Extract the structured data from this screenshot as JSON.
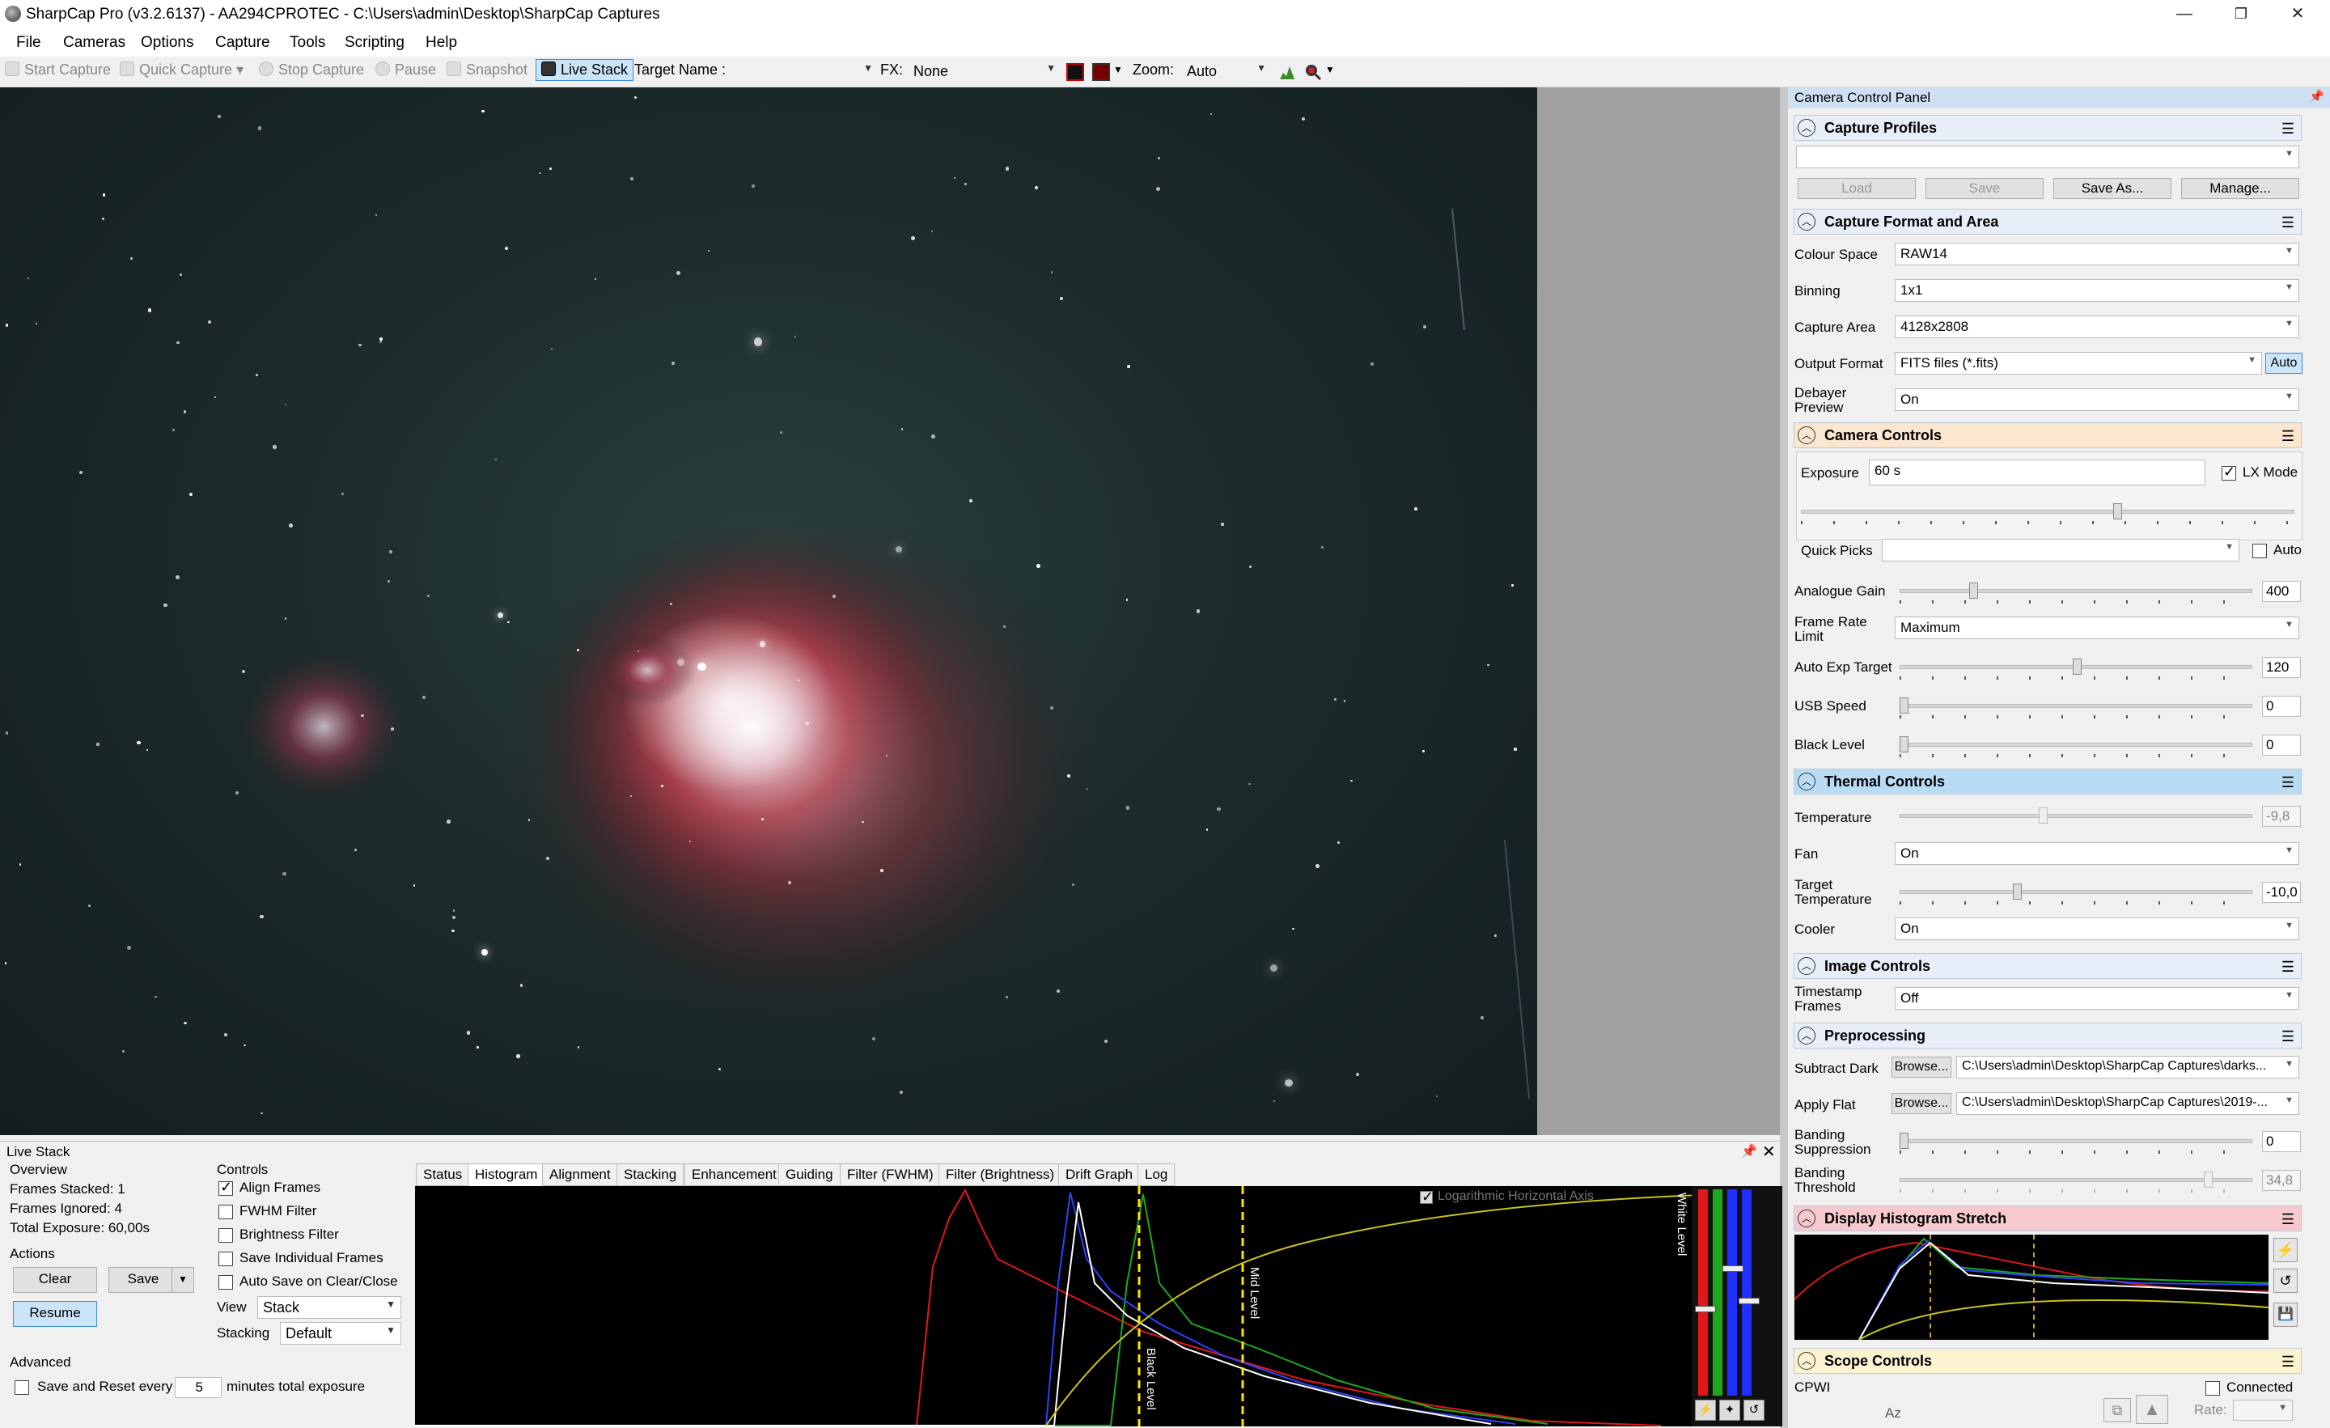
{
  "window": {
    "title": "SharpCap Pro (v3.2.6137)  -  AA294CPROTEC  -  C:\\Users\\admin\\Desktop\\SharpCap Captures",
    "minimize": "—",
    "restore": "❐",
    "close": "✕"
  },
  "menu": [
    "File",
    "Cameras",
    "Options",
    "Capture",
    "Tools",
    "Scripting",
    "Help"
  ],
  "toolbar": {
    "start_capture": "Start Capture",
    "quick_capture": "Quick Capture",
    "stop_capture": "Stop Capture",
    "pause": "Pause",
    "snapshot": "Snapshot",
    "live_stack": "Live Stack",
    "target_name_label": "Target Name :",
    "target_name_value": "",
    "fx_label": "FX:",
    "fx_value": "None",
    "zoom_label": "Zoom:",
    "zoom_value": "Auto"
  },
  "live_stack": {
    "title": "Live Stack",
    "overview_label": "Overview",
    "frames_stacked": "Frames Stacked:  1",
    "frames_ignored": "Frames Ignored:  4",
    "total_exposure": "Total Exposure:   60,00s",
    "actions_label": "Actions",
    "clear": "Clear",
    "save": "Save",
    "resume": "Resume",
    "controls_label": "Controls",
    "align_frames": "Align Frames",
    "fwhm_filter": "FWHM Filter",
    "brightness_filter": "Brightness Filter",
    "save_individual": "Save Individual Frames",
    "auto_save": "Auto Save on Clear/Close",
    "view_label": "View",
    "view_value": "Stack",
    "stacking_label": "Stacking",
    "stacking_value": "Default",
    "advanced_label": "Advanced",
    "save_reset_label": "Save and Reset every",
    "save_reset_value": "5",
    "minutes_label": "minutes total exposure",
    "tabs": [
      "Status",
      "Histogram",
      "Alignment",
      "Stacking",
      "Enhancement",
      "Guiding",
      "Filter (FWHM)",
      "Filter (Brightness)",
      "Drift Graph",
      "Log"
    ],
    "active_tab": "Histogram",
    "log_axis_label": "Logarithmic Horizontal Axis",
    "black_level": "Black Level",
    "mid_level": "Mid Level",
    "white_level": "White Level"
  },
  "panel": {
    "title": "Camera Control Panel",
    "capture_profiles": {
      "title": "Capture Profiles",
      "profile_value": "",
      "load": "Load",
      "save": "Save",
      "save_as": "Save As...",
      "manage": "Manage..."
    },
    "capture_format": {
      "title": "Capture Format and Area",
      "colour_space_label": "Colour Space",
      "colour_space": "RAW14",
      "binning_label": "Binning",
      "binning": "1x1",
      "capture_area_label": "Capture Area",
      "capture_area": "4128x2808",
      "output_format_label": "Output Format",
      "output_format": "FITS files (*.fits)",
      "auto": "Auto",
      "debayer_label_1": "Debayer",
      "debayer_label_2": "Preview",
      "debayer": "On"
    },
    "camera_controls": {
      "title": "Camera Controls",
      "exposure_label": "Exposure",
      "exposure": "60 s",
      "lx_mode": "LX Mode",
      "quick_picks_label": "Quick Picks",
      "quick_picks": "",
      "auto": "Auto",
      "analogue_gain_label": "Analogue Gain",
      "analogue_gain": "400",
      "frame_rate_label_1": "Frame Rate",
      "frame_rate_label_2": "Limit",
      "frame_rate": "Maximum",
      "auto_exp_label": "Auto Exp Target",
      "auto_exp": "120",
      "usb_speed_label": "USB Speed",
      "usb_speed": "0",
      "black_level_label": "Black Level",
      "black_level": "0"
    },
    "thermal": {
      "title": "Thermal Controls",
      "temperature_label": "Temperature",
      "temperature": "-9,8",
      "fan_label": "Fan",
      "fan": "On",
      "target_temp_label_1": "Target",
      "target_temp_label_2": "Temperature",
      "target_temp": "-10,0",
      "cooler_label": "Cooler",
      "cooler": "On"
    },
    "image_controls": {
      "title": "Image Controls",
      "timestamp_label_1": "Timestamp",
      "timestamp_label_2": "Frames",
      "timestamp": "Off"
    },
    "preprocessing": {
      "title": "Preprocessing",
      "subtract_dark_label": "Subtract Dark",
      "browse": "Browse...",
      "subtract_dark": "C:\\Users\\admin\\Desktop\\SharpCap Captures\\darks...",
      "apply_flat_label": "Apply Flat",
      "apply_flat": "C:\\Users\\admin\\Desktop\\SharpCap Captures\\2019-...",
      "banding_supp_label_1": "Banding",
      "banding_supp_label_2": "Suppression",
      "banding_supp": "0",
      "banding_thresh_label_1": "Banding",
      "banding_thresh_label_2": "Threshold",
      "banding_thresh": "34,8"
    },
    "display_histogram": {
      "title": "Display Histogram Stretch"
    },
    "scope_controls": {
      "title": "Scope Controls",
      "scope_name": "CPWI",
      "connected": "Connected",
      "az": "Az",
      "rate_label": "Rate:"
    }
  },
  "colors": {
    "camera_controls_header": "#fbe6cf",
    "thermal_header": "#b9dcf4",
    "display_histogram_header": "#f6c9cf",
    "scope_header": "#fbf2cf",
    "neutral_header": "#e8eef7"
  }
}
